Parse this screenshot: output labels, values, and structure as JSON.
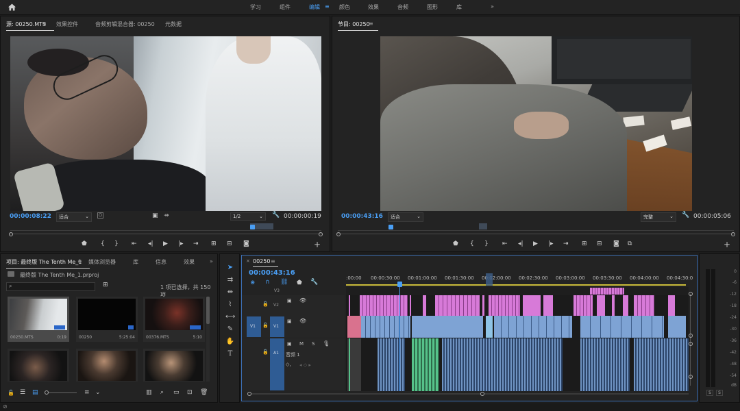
{
  "workspaces": [
    "学习",
    "组件",
    "编辑",
    "颜色",
    "效果",
    "音频",
    "图形",
    "库"
  ],
  "active_workspace": "编辑",
  "source_panel": {
    "tabs": [
      "源: 00250.MTS",
      "效果控件",
      "音频剪辑混合器: 00250",
      "元数据"
    ],
    "timecode_in": "00:00:08:22",
    "fit": "适合",
    "resolution": "1/2",
    "timecode_out": "00:00:00:19"
  },
  "program_panel": {
    "tab": "节目: 00250",
    "timecode_in": "00:00:43:16",
    "fit": "适合",
    "quality": "完整",
    "timecode_out": "00:00:05:06"
  },
  "project_panel": {
    "tabs": [
      "项目: 最终版 The Tenth Me_1",
      "媒体浏览器",
      "库",
      "信息",
      "效果"
    ],
    "file": "最终版 The Tenth Me_1.prproj",
    "status": "1 项已选择，共 150 项",
    "items": [
      {
        "name": "00250.MTS",
        "duration": "0:19"
      },
      {
        "name": "00250",
        "duration": "5:25:04"
      },
      {
        "name": "00376.MTS",
        "duration": "5:10"
      }
    ]
  },
  "timeline": {
    "tab": "00250",
    "timecode": "00:00:43:16",
    "ruler": [
      ":00:00",
      "00:00:30:00",
      "00:01:00:00",
      "00:01:30:00",
      "00:02:00:00",
      "00:02:30:00",
      "00:03:00:00",
      "00:03:30:00",
      "00:04:00:00",
      "00:04:30:0"
    ],
    "tracks": {
      "v3": "V3",
      "v2": "V2",
      "v1": "V1",
      "v1_src": "V1",
      "a1": "A1",
      "a1_name": "音频 1"
    },
    "m_label": "M",
    "s_label": "S"
  },
  "meter": {
    "scale": [
      "0",
      "-6",
      "-12",
      "-18",
      "-24",
      "-30",
      "-36",
      "-42",
      "-48",
      "-54",
      "dB"
    ],
    "solo": [
      "S",
      "S"
    ]
  }
}
